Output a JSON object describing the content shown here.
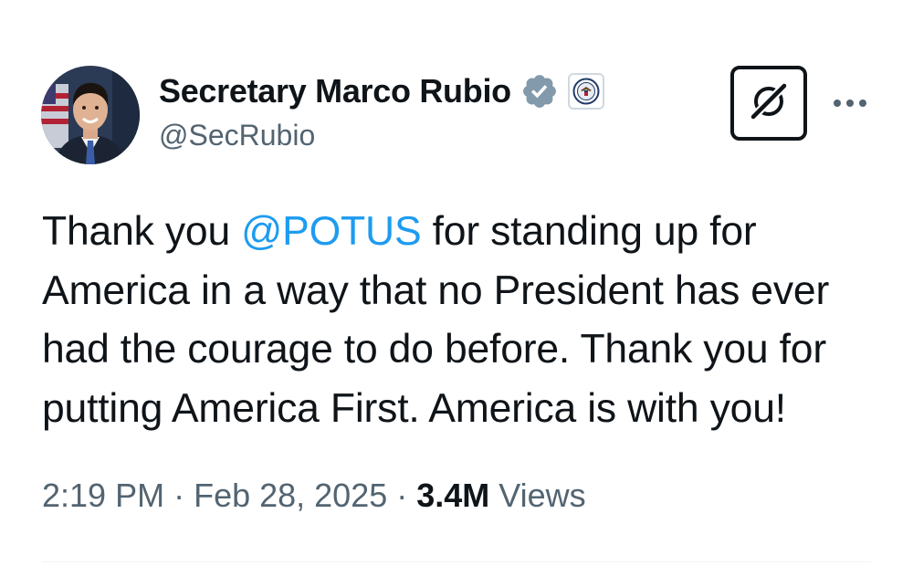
{
  "author": {
    "display_name": "Secretary Marco Rubio",
    "handle": "@SecRubio",
    "verified_badge_icon": "gray-verified-check-icon",
    "affiliate_badge_icon": "state-department-seal-icon"
  },
  "actions": {
    "grok_icon": "grok-icon",
    "more_icon": "more-horizontal-icon"
  },
  "tweet": {
    "line1_pre": "Thank you ",
    "mention": "@POTUS",
    "line1_post": " for standing up for",
    "line2": "America in a way that no President has ever",
    "line3": "had the courage to do before. Thank you for",
    "line4": "putting America First. America is with you!"
  },
  "meta": {
    "time": "2:19 PM",
    "separator": "·",
    "date": "Feb 28, 2025",
    "views_count": "3.4M",
    "views_label": "Views"
  },
  "colors": {
    "text": "#0f1419",
    "secondary": "#536471",
    "link": "#1d9bf0",
    "verified_gray": "#829aab"
  }
}
